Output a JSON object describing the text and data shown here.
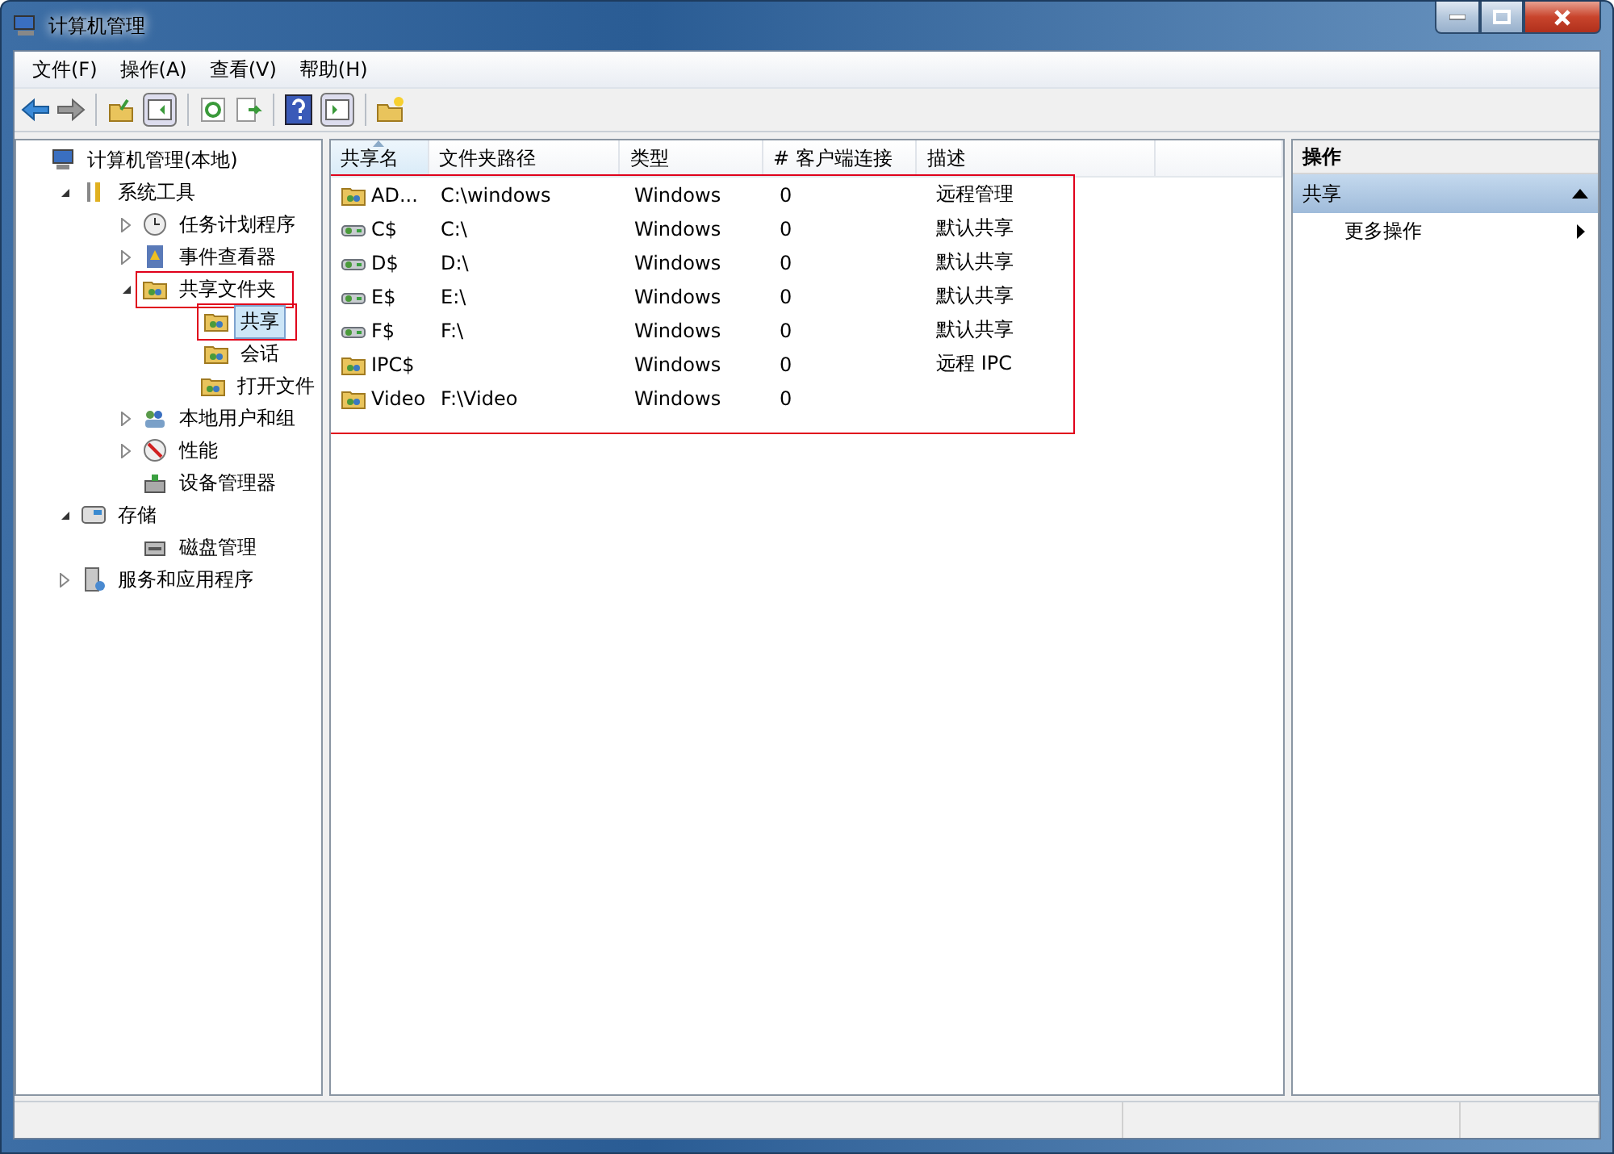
{
  "window": {
    "title": "计算机管理"
  },
  "menu": [
    "文件(F)",
    "操作(A)",
    "查看(V)",
    "帮助(H)"
  ],
  "tree": [
    {
      "label": "计算机管理(本地)",
      "selected": false,
      "marked": false,
      "children": [
        {
          "label": "系统工具",
          "expanded": true,
          "selected": false,
          "marked": false,
          "children": [
            {
              "label": "任务计划程序",
              "expanded": false,
              "selected": false,
              "marked": false
            },
            {
              "label": "事件查看器",
              "expanded": false,
              "selected": false,
              "marked": false
            },
            {
              "label": "共享文件夹",
              "expanded": true,
              "selected": false,
              "marked": true,
              "children": [
                {
                  "label": "共享",
                  "selected": true,
                  "marked": true
                },
                {
                  "label": "会话",
                  "selected": false,
                  "marked": false
                },
                {
                  "label": "打开文件",
                  "selected": false,
                  "marked": false
                }
              ]
            },
            {
              "label": "本地用户和组",
              "expanded": false,
              "selected": false,
              "marked": false
            },
            {
              "label": "性能",
              "expanded": false,
              "selected": false,
              "marked": false
            },
            {
              "label": "设备管理器",
              "selected": false,
              "marked": false
            }
          ]
        },
        {
          "label": "存储",
          "expanded": true,
          "selected": false,
          "marked": false,
          "children": [
            {
              "label": "磁盘管理",
              "selected": false,
              "marked": false
            }
          ]
        },
        {
          "label": "服务和应用程序",
          "expanded": false,
          "selected": false,
          "marked": false
        }
      ]
    }
  ],
  "table": {
    "marked": true,
    "columns": [
      {
        "label": "共享名",
        "sorted": true
      },
      {
        "label": "文件夹路径",
        "sorted": false
      },
      {
        "label": "类型",
        "sorted": false
      },
      {
        "label": "# 客户端连接",
        "sorted": false
      },
      {
        "label": "描述",
        "sorted": false
      }
    ],
    "rows": [
      {
        "kind": "folder",
        "cells": [
          "AD...",
          "C:\\windows",
          "Windows",
          "0",
          "远程管理"
        ]
      },
      {
        "kind": "drive",
        "cells": [
          "C$",
          "C:\\",
          "Windows",
          "0",
          "默认共享"
        ]
      },
      {
        "kind": "drive",
        "cells": [
          "D$",
          "D:\\",
          "Windows",
          "0",
          "默认共享"
        ]
      },
      {
        "kind": "drive",
        "cells": [
          "E$",
          "E:\\",
          "Windows",
          "0",
          "默认共享"
        ]
      },
      {
        "kind": "drive",
        "cells": [
          "F$",
          "F:\\",
          "Windows",
          "0",
          "默认共享"
        ]
      },
      {
        "kind": "folder",
        "cells": [
          "IPC$",
          "",
          "Windows",
          "0",
          "远程 IPC"
        ]
      },
      {
        "kind": "folder",
        "cells": [
          "Video",
          "F:\\Video",
          "Windows",
          "0",
          ""
        ]
      }
    ]
  },
  "actions": {
    "title": "操作",
    "sections": [
      {
        "label": "共享",
        "expanded": true,
        "items": [
          {
            "label": "更多操作",
            "submenu": true
          }
        ]
      }
    ]
  }
}
